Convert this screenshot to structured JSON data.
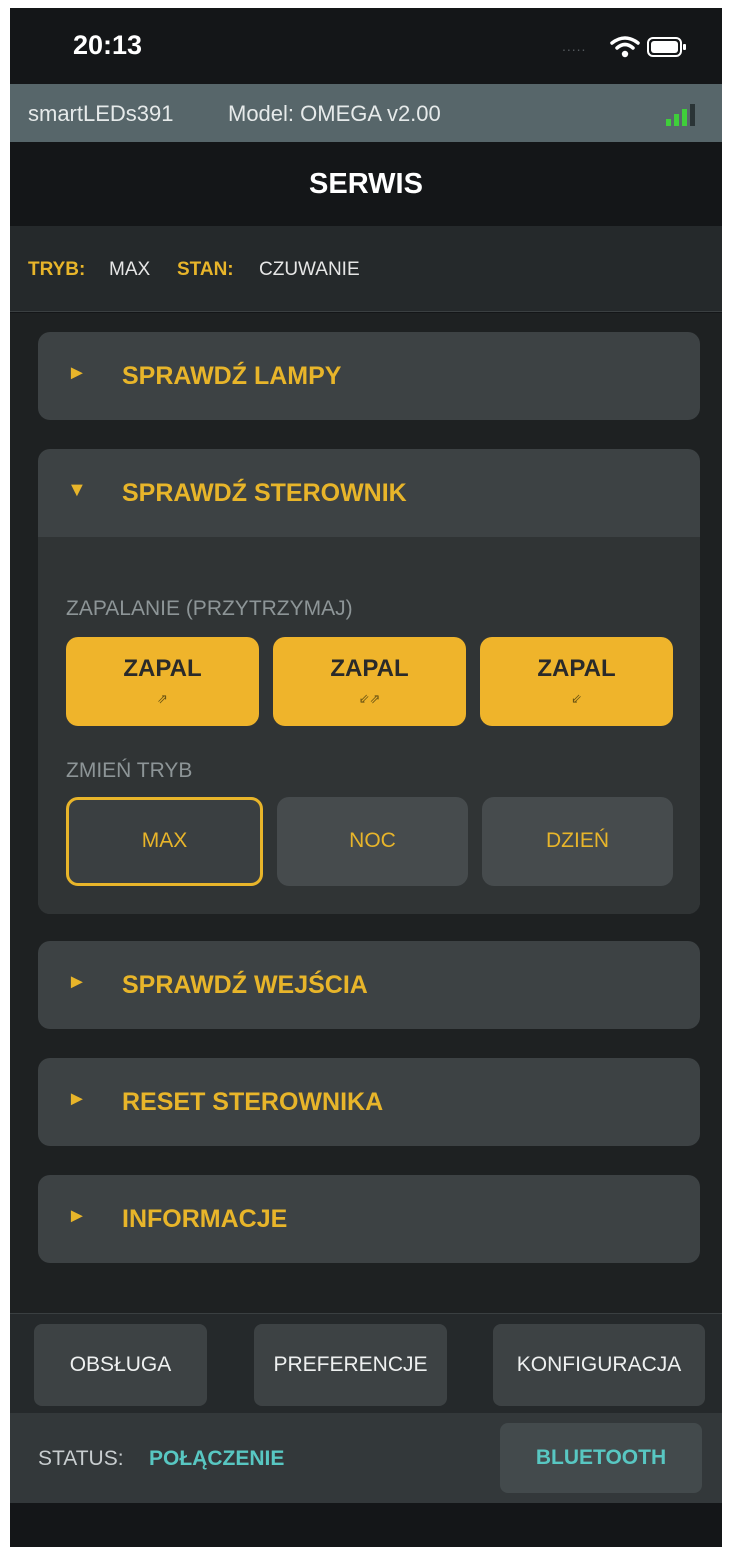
{
  "status_bar": {
    "time": "20:13",
    "signal": "....."
  },
  "device_bar": {
    "name": "smartLEDs391",
    "model": "Model: OMEGA v2.00"
  },
  "page": {
    "title": "SERWIS"
  },
  "mode_bar": {
    "mode_key": "TRYB:",
    "mode_value": "MAX",
    "state_key": "STAN:",
    "state_value": "CZUWANIE"
  },
  "sections": [
    {
      "arrow": "►",
      "title": "SPRAWDŹ LAMPY",
      "expanded": false
    },
    {
      "arrow": "▼",
      "title": "SPRAWDŹ STEROWNIK",
      "expanded": true
    },
    {
      "arrow": "►",
      "title": "SPRAWDŹ WEJŚCIA",
      "expanded": false
    },
    {
      "arrow": "►",
      "title": "RESET STEROWNIKA",
      "expanded": false
    },
    {
      "arrow": "►",
      "title": "INFORMACJE",
      "expanded": false
    }
  ],
  "controller": {
    "ignite_label": "ZAPALANIE (PRZYTRZYMAJ)",
    "ignite_buttons": [
      {
        "label": "ZAPAL",
        "icon": "⇗"
      },
      {
        "label": "ZAPAL",
        "icon": "⇙⇗"
      },
      {
        "label": "ZAPAL",
        "icon": "⇙"
      }
    ],
    "mode_label": "ZMIEŃ TRYB",
    "mode_buttons": [
      {
        "label": "MAX",
        "active": true
      },
      {
        "label": "NOC",
        "active": false
      },
      {
        "label": "DZIEŃ",
        "active": false
      }
    ]
  },
  "bottom_nav": [
    "OBSŁUGA",
    "PREFERENCJE",
    "KONFIGURACJA"
  ],
  "status_footer": {
    "key": "STATUS:",
    "value": "POŁĄCZENIE",
    "button": "BLUETOOTH"
  },
  "colors": {
    "accent": "#efb42b",
    "status": "#58c7c2",
    "background": "#1e2122"
  }
}
